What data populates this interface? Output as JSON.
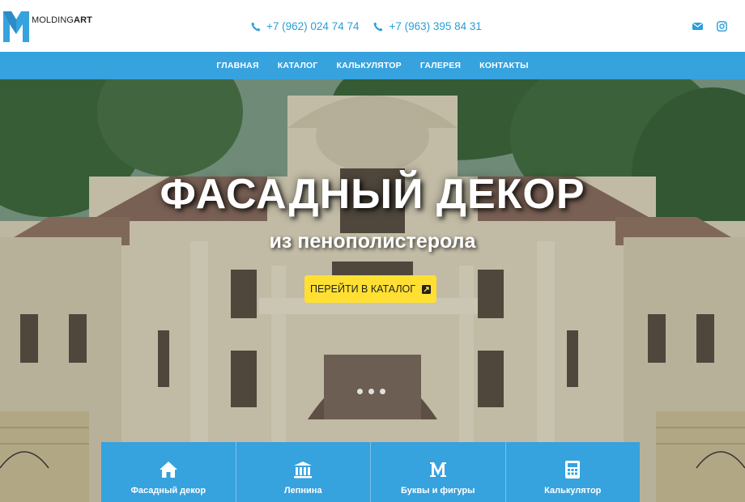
{
  "brand": {
    "name_regular": "MOLDING",
    "name_bold": "ART",
    "colors": {
      "accent": "#36a2de",
      "cta": "#ffe032",
      "phone": "#2a9fd8"
    }
  },
  "header": {
    "phones": [
      {
        "icon": "phone-icon",
        "text": "+7 (962) 024 74 74"
      },
      {
        "icon": "phone-icon",
        "text": "+7 (963) 395 84 31"
      }
    ],
    "socials": [
      {
        "icon": "mail-icon"
      },
      {
        "icon": "instagram-icon"
      }
    ]
  },
  "nav": {
    "items": [
      {
        "label": "ГЛАВНАЯ"
      },
      {
        "label": "КАТАЛОГ"
      },
      {
        "label": "КАЛЬКУЛЯТОР"
      },
      {
        "label": "ГАЛЕРЕЯ"
      },
      {
        "label": "КОНТАКТЫ"
      }
    ]
  },
  "hero": {
    "title": "ФАСАДНЫЙ ДЕКОР",
    "subtitle": "из пенополистерола",
    "cta_label": "ПЕРЕЙТИ В КАТАЛОГ",
    "slides": 3
  },
  "tiles": [
    {
      "icon": "home-icon",
      "label": "Фасадный декор"
    },
    {
      "icon": "columns-icon",
      "label": "Лепнина"
    },
    {
      "icon": "letter-m-icon",
      "label": "Буквы и фигуры"
    },
    {
      "icon": "calculator-icon",
      "label": "Калькулятор"
    }
  ]
}
